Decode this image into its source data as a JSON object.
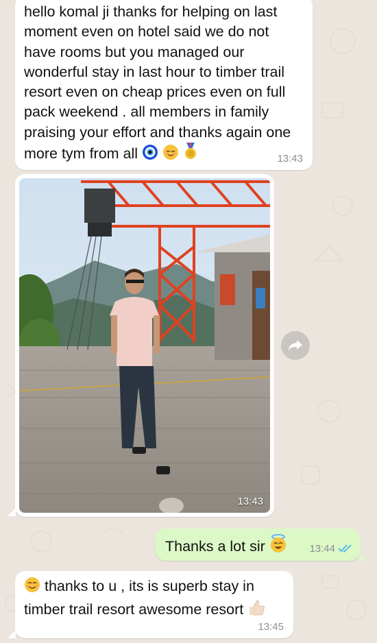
{
  "chat": {
    "messages": [
      {
        "direction": "incoming",
        "text": "hello komal ji thanks for helping on last moment even on hotel said we do not have rooms but you managed our wonderful stay in last hour to timber trail resort even on cheap prices even on full pack weekend . all members in family praising your effort and thanks again one more tym from all",
        "emojis": [
          "nazar-amulet-emoji",
          "relieved-face-emoji",
          "medal-emoji"
        ],
        "time": "13:43"
      },
      {
        "direction": "incoming",
        "type": "photo",
        "time": "13:43"
      },
      {
        "direction": "outgoing",
        "text": "Thanks a lot sir",
        "emojis": [
          "smiling-face-with-halo-emoji"
        ],
        "time": "13:44",
        "status": "read"
      },
      {
        "direction": "incoming",
        "text_before_emoji": "",
        "text": "thanks to u , its is superb stay in timber trail resort awesome resort",
        "emojis": [
          "smiling-face-emoji",
          "thumbs-up-emoji"
        ],
        "time": "13:45"
      }
    ]
  },
  "colors": {
    "incoming_bubble": "#ffffff",
    "outgoing_bubble": "#dcf8c6",
    "wallpaper": "#ebe5de",
    "read_ticks": "#4fb6ec",
    "timestamp": "#8a8f94"
  },
  "icons": {
    "forward": "forward-arrow-icon",
    "read_receipt": "double-check-icon"
  }
}
